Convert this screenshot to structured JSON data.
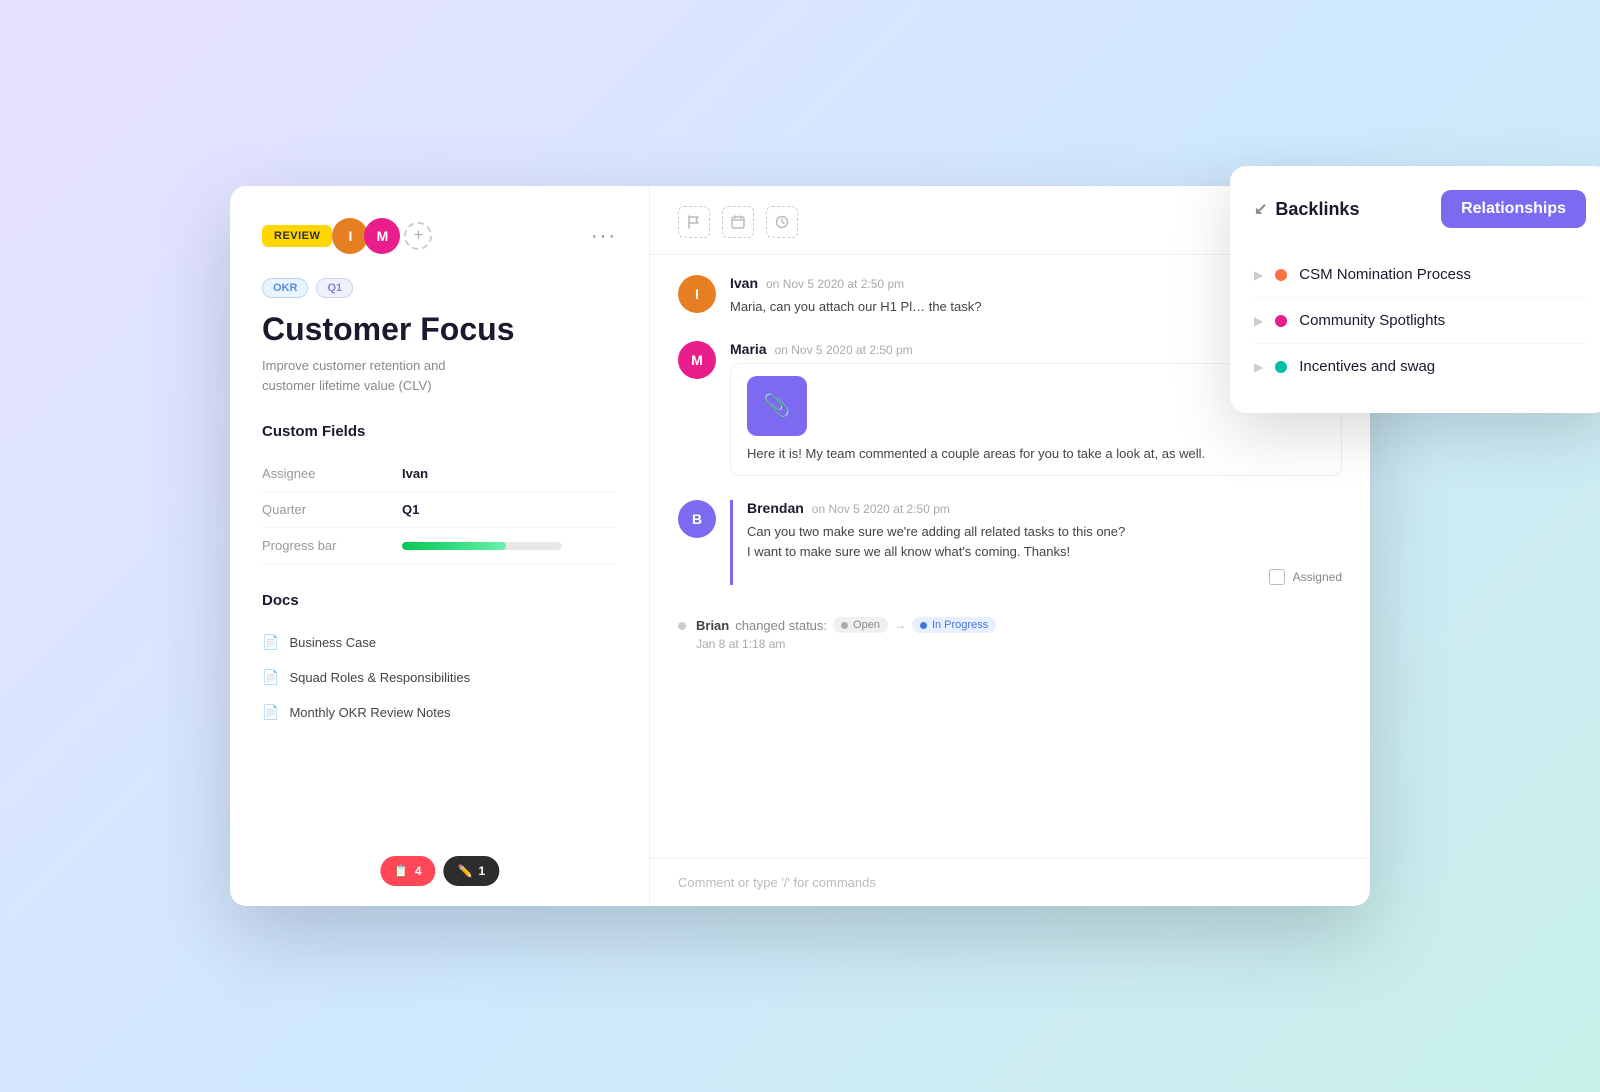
{
  "window": {
    "title": "Customer Focus"
  },
  "left_panel": {
    "review_badge": "REVIEW",
    "tags": [
      "OKR",
      "Q1"
    ],
    "doc_title": "Customer Focus",
    "doc_subtitle": "Improve customer retention and\ncustomer lifetime value (CLV)",
    "custom_fields_title": "Custom Fields",
    "fields": [
      {
        "label": "Assignee",
        "value": "Ivan"
      },
      {
        "label": "Quarter",
        "value": "Q1"
      },
      {
        "label": "Progress bar",
        "value": "progress",
        "progress": 65
      }
    ],
    "docs_title": "Docs",
    "docs": [
      "Business Case",
      "Squad Roles & Responsibilities",
      "Monthly OKR Review Notes"
    ],
    "badges": [
      {
        "icon": "📋",
        "count": "4",
        "color": "red"
      },
      {
        "icon": "✏️",
        "count": "1",
        "color": "dark"
      }
    ]
  },
  "toolbar": {
    "icons": [
      "flag",
      "calendar",
      "clock"
    ]
  },
  "messages": [
    {
      "id": 1,
      "author": "Ivan",
      "time": "on Nov 5 2020 at 2:50 pm",
      "text": "Maria, can you attach our H1 Pl… the task?",
      "avatar_color": "#e67e22",
      "initials": "I"
    },
    {
      "id": 2,
      "author": "Maria",
      "time": "on Nov 5 2020 at 2:50 pm",
      "text": "Here it is! My team commented a couple areas for you to take a look at, as well.",
      "has_attachment": true,
      "avatar_color": "#e91e8c",
      "initials": "M"
    },
    {
      "id": 3,
      "author": "Brendan",
      "time": "on Nov 5 2020 at 2:50 pm",
      "text": "Can you two make sure we're adding all related tasks to this one?\nI want to make sure we all know what's coming. Thanks!",
      "has_assigned": true,
      "assigned_label": "Assigned",
      "avatar_color": "#7c6af0",
      "initials": "B"
    }
  ],
  "status_change": {
    "user": "Brian",
    "action": "changed status:",
    "from": "Open",
    "to": "In Progress",
    "date": "Jan 8 at 1:18 am"
  },
  "comment_placeholder": "Comment or type '/' for commands",
  "backlinks": {
    "title": "Backlinks",
    "tab_active": "Relationships",
    "items": [
      {
        "label": "CSM Nomination Process",
        "color": "#ff7043"
      },
      {
        "label": "Community Spotlights",
        "color": "#e91e8c"
      },
      {
        "label": "Incentives and swag",
        "color": "#00bfa5"
      }
    ]
  }
}
